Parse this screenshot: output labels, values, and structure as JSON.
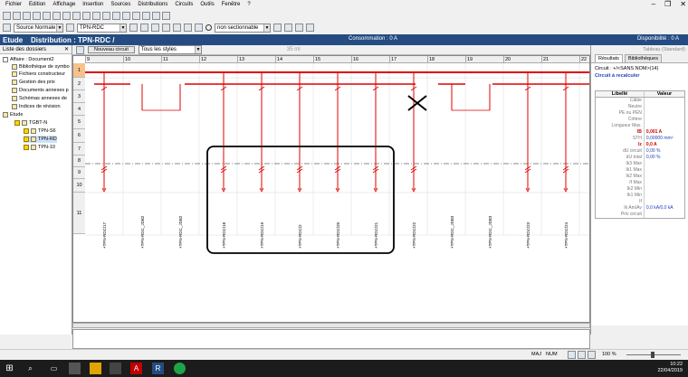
{
  "menu": {
    "items": [
      "Fichier",
      "Edition",
      "Affichage",
      "Insertion",
      "Sources",
      "Distributions",
      "Circuits",
      "Outils",
      "Fenêtre",
      "?"
    ]
  },
  "toolbar2": {
    "source_combo": "Source Normale",
    "circuit_combo": "TPN-RDC",
    "non_sectionnable": "non sectionnable"
  },
  "header": {
    "etude": "Etude",
    "distribution": "Distribution : TPN-RDC /",
    "consommation": "Consommation : 0 A",
    "disponibilite": "Disponibilité : 0 A"
  },
  "left_panel": {
    "title": "Liste des dossiers",
    "tree": [
      {
        "label": "Affaire : Document2"
      },
      {
        "label": "Bibliothèque de symbo"
      },
      {
        "label": "Fichiers constructeur"
      },
      {
        "label": "Gestion des prix"
      },
      {
        "label": "Documents annexes p"
      },
      {
        "label": "Schémas annexes de"
      },
      {
        "label": "Indices de révision"
      },
      {
        "label": "Etude"
      },
      {
        "label": "TGBT-N"
      },
      {
        "label": "TPN-S6"
      },
      {
        "label": "TPN-RD"
      },
      {
        "label": "TPN-10"
      }
    ]
  },
  "sheet_toolbar": {
    "new_circuit": "Nouveau circuit",
    "styles": "Tous les styles",
    "size": "35 ml"
  },
  "grid": {
    "columns": [
      "9",
      "10",
      "11",
      "12",
      "13",
      "14",
      "15",
      "16",
      "17",
      "18",
      "19",
      "20",
      "21",
      "22"
    ],
    "rows": [
      "1",
      "2",
      "3",
      "4",
      "5",
      "6",
      "7",
      "8",
      "9",
      "10",
      "11"
    ],
    "circuits": [
      "+TPN-RDC/17",
      "+TPN-RDC_JDB2",
      "+TPN-RDC_JDB2",
      "+TPN-RDC/18",
      "+TPN-RDC/19",
      "+TPN-RDC/2",
      "+TPN-RDC/20",
      "+TPN-RDC/21",
      "+TPN-RDC/22",
      "+TPN-RDC_JDB3",
      "+TPN-RDC_JDB3",
      "+TPN-RDC/23",
      "+TPN-RDC/24"
    ]
  },
  "right_panel": {
    "header_hint": "Tableau (Standard)",
    "tabs": [
      "Résultats",
      "Bibliothèques"
    ],
    "circuit_line": "Circuit : +/<SANS NOM>(14)",
    "recalc": "Circuit à recalculer",
    "table_headers": [
      "Libellé",
      "Valeur"
    ],
    "props": [
      {
        "label": "Câble",
        "value": ""
      },
      {
        "label": "Neutre",
        "value": ""
      },
      {
        "label": "PE ou PEN",
        "value": ""
      },
      {
        "label": "Critère",
        "value": ""
      },
      {
        "label": "Longueur Max.",
        "value": ""
      },
      {
        "label": "IB",
        "value": "0,001 A"
      },
      {
        "label": "STH",
        "value": "0,00000 mm²"
      },
      {
        "label": "Iz",
        "value": "0,0 A"
      },
      {
        "label": "dU circuit",
        "value": "0,00 %"
      },
      {
        "label": "dU total",
        "value": "0,00 %"
      },
      {
        "label": "Ik3 Max",
        "value": ""
      },
      {
        "label": "Ik1 Max",
        "value": ""
      },
      {
        "label": "Ik2 Max",
        "value": ""
      },
      {
        "label": "If Max",
        "value": ""
      },
      {
        "label": "Ik2 Min",
        "value": ""
      },
      {
        "label": "Ik1 Min",
        "value": ""
      },
      {
        "label": "If",
        "value": ""
      },
      {
        "label": "Ik Am/Av",
        "value": "0,0 kA/0,0 kA"
      },
      {
        "label": "Prix circuit",
        "value": ""
      }
    ]
  },
  "statusbar": {
    "maj": "MAJ",
    "num": "NUM",
    "zoom": "100 %"
  },
  "taskbar": {
    "time": "10:22",
    "date": "22/04/2019"
  },
  "colors": {
    "title_bg": "#244c82",
    "busbar": "#e00000",
    "annotation": "#000000",
    "highlight": "#f7c28a"
  }
}
